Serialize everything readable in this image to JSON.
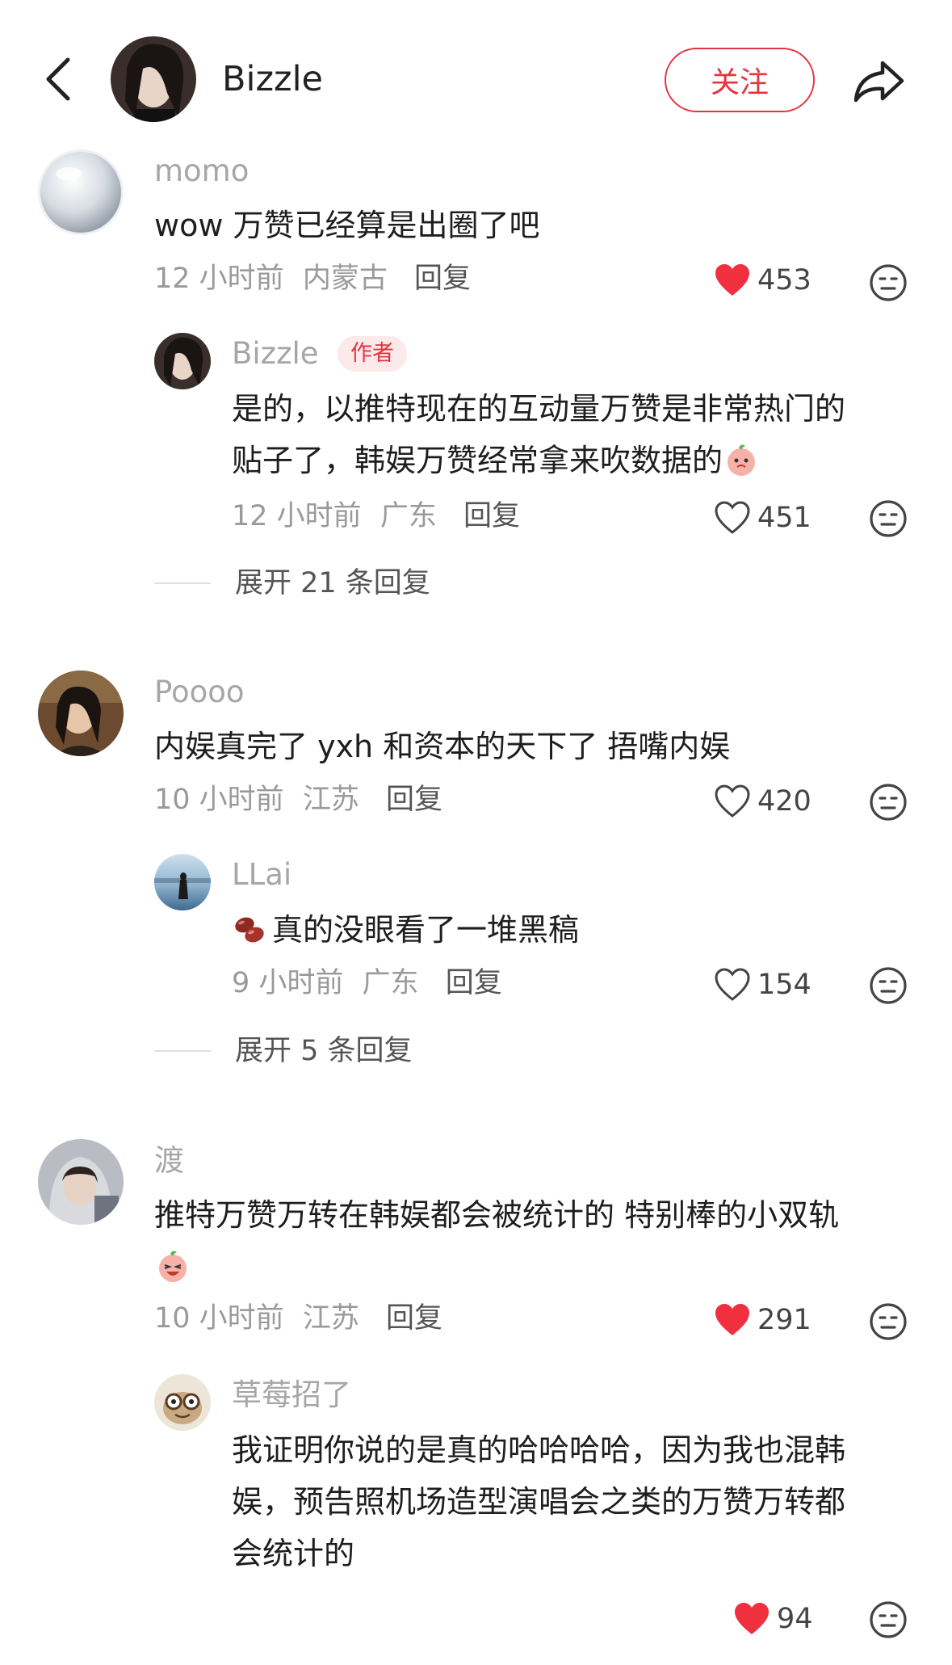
{
  "header": {
    "name": "Bizzle",
    "follow_label": "关注",
    "icons": {
      "back": "chevron-left-icon",
      "share": "share-arrow-icon"
    }
  },
  "colors": {
    "accent": "#e5343f",
    "like_filled": "#f0303f",
    "secondary_text": "#9a9a9a"
  },
  "comments": [
    {
      "user": "momo",
      "text": "wow 万赞已经算是出圈了吧",
      "time": "12 小时前",
      "location": "内蒙古",
      "reply_label": "回复",
      "likes": "453",
      "liked": true,
      "replies": [
        {
          "user": "Bizzle",
          "badge": "作者",
          "text_line1": "是的，以推特现在的互动量万赞是非常热门的",
          "text_line2": "贴子了，韩娱万赞经常拿来吹数据的",
          "time": "12 小时前",
          "location": "广东",
          "reply_label": "回复",
          "likes": "451",
          "liked": false
        }
      ],
      "expand_label": "展开 21 条回复"
    },
    {
      "user": "Poooo",
      "text": "内娱真完了 yxh 和资本的天下了 捂嘴内娱",
      "time": "10 小时前",
      "location": "江苏",
      "reply_label": "回复",
      "likes": "420",
      "liked": false,
      "replies": [
        {
          "user": "LLai",
          "text": "真的没眼看了一堆黑稿",
          "time": "9 小时前",
          "location": "广东",
          "reply_label": "回复",
          "likes": "154",
          "liked": false
        }
      ],
      "expand_label": "展开 5 条回复"
    },
    {
      "user": "渡",
      "text": "推特万赞万转在韩娱都会被统计的 特别棒的小双轨",
      "time": "10 小时前",
      "location": "江苏",
      "reply_label": "回复",
      "likes": "291",
      "liked": true,
      "replies": [
        {
          "user": "草莓招了",
          "text_line1": "我证明你说的是真的哈哈哈哈，因为我也混韩",
          "text_line2": "娱，预告照机场造型演唱会之类的万赞万转都",
          "text_line3": "会统计的",
          "likes": "94",
          "liked": true
        }
      ]
    }
  ]
}
